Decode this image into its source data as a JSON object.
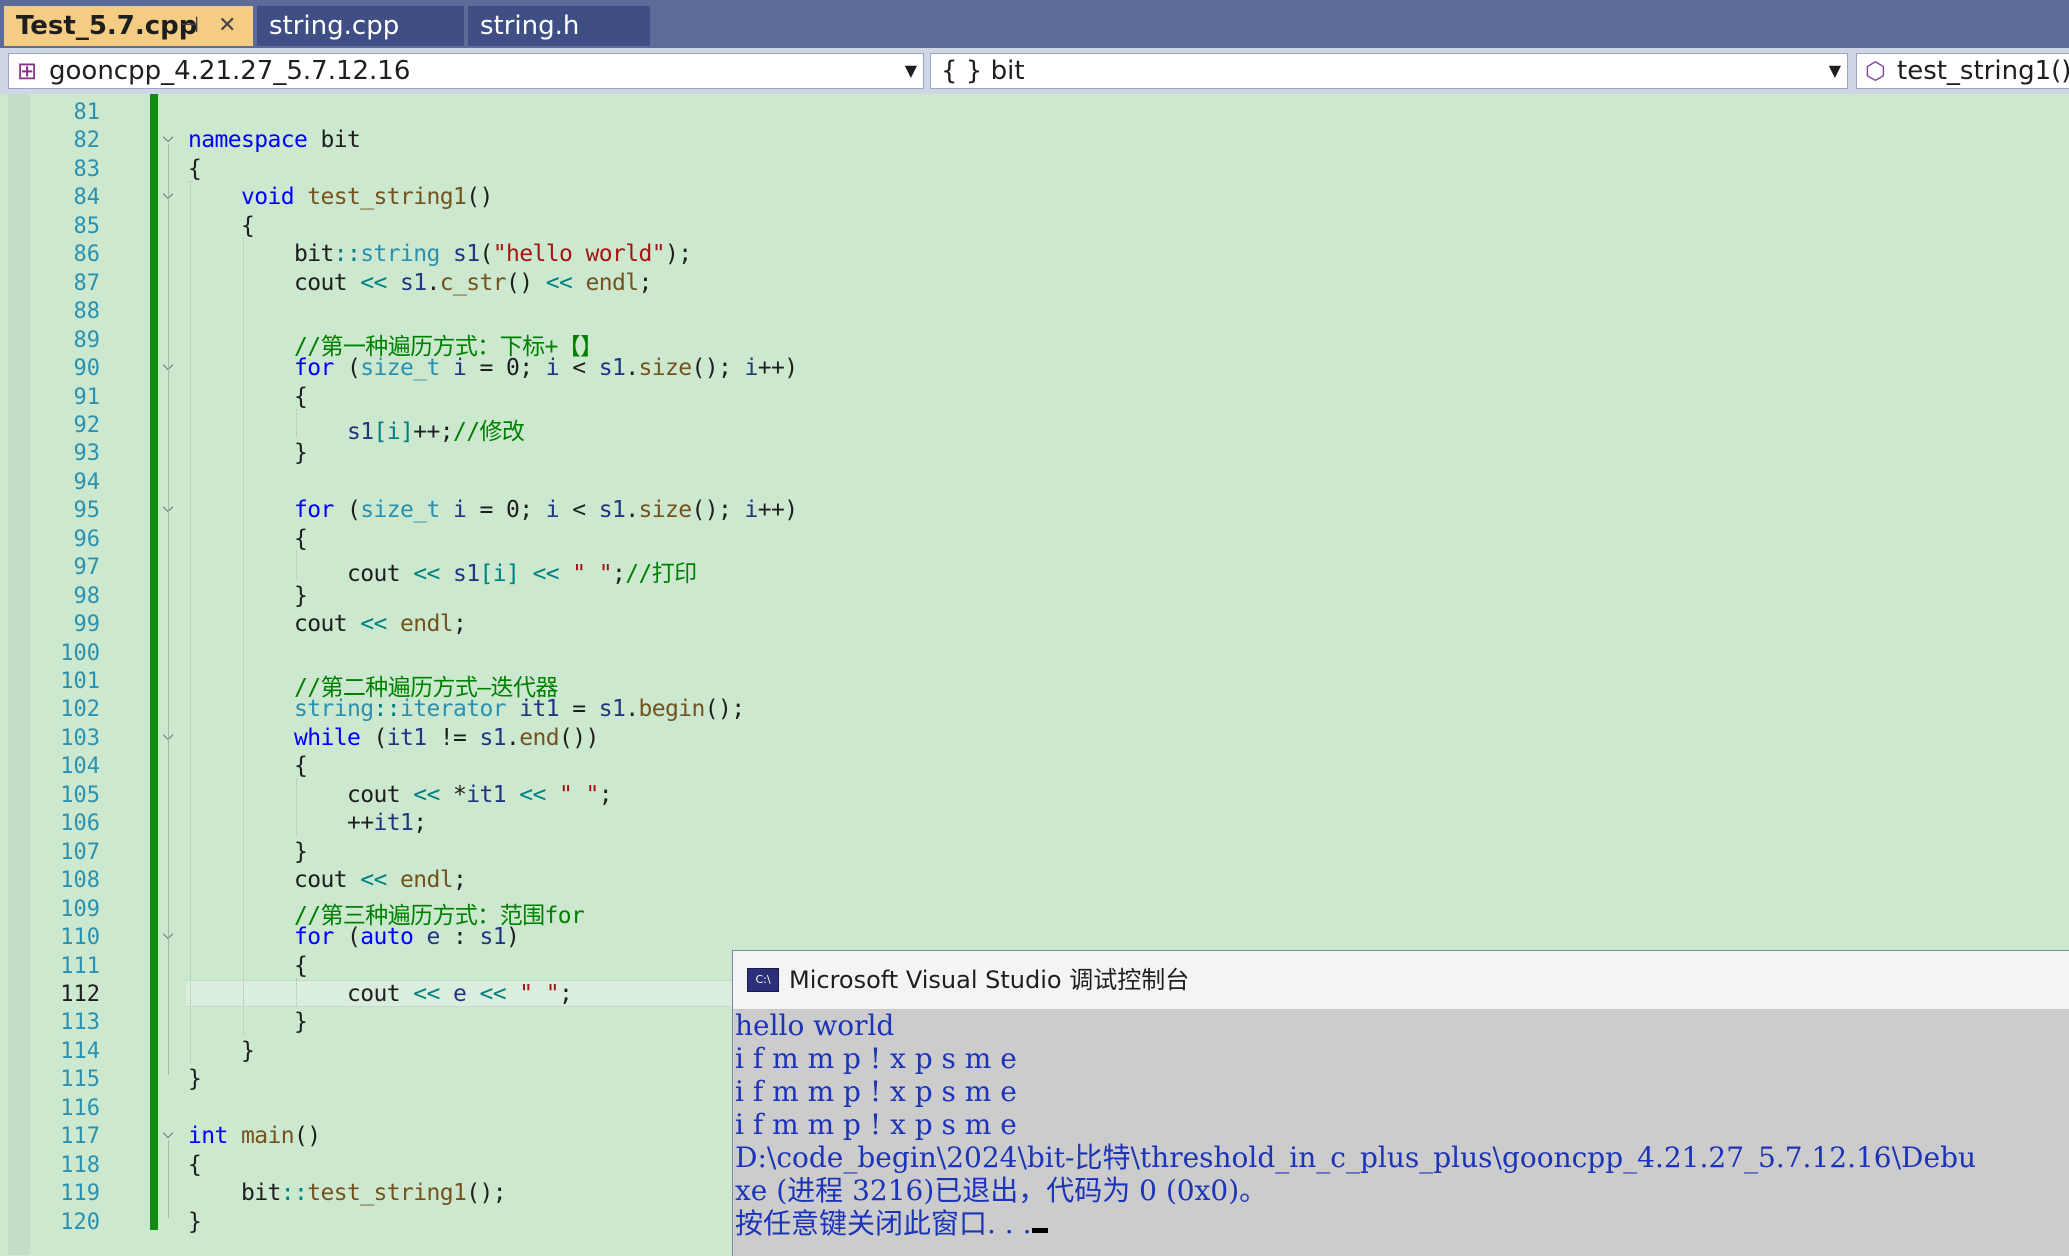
{
  "tabs": [
    {
      "label": "Test_5.7.cpp",
      "active": true,
      "pin_icon": "pin-icon",
      "close_icon": "close-icon"
    },
    {
      "label": "string.cpp",
      "active": false
    },
    {
      "label": "string.h",
      "active": false
    }
  ],
  "nav": {
    "project": "gooncpp_4.21.27_5.7.12.16",
    "scope": "{ } bit",
    "member": "test_string1()"
  },
  "editor": {
    "current_line": "112",
    "lines": [
      {
        "num": "81",
        "indent": 0,
        "fold": "",
        "tokens": []
      },
      {
        "num": "82",
        "indent": 0,
        "fold": "v",
        "tokens": [
          [
            "kw",
            "namespace"
          ],
          [
            "ns",
            " bit"
          ]
        ]
      },
      {
        "num": "83",
        "indent": 0,
        "fold": "",
        "tokens": [
          [
            "ns",
            "{"
          ]
        ]
      },
      {
        "num": "84",
        "indent": 1,
        "fold": "v",
        "tokens": [
          [
            "kw",
            "void"
          ],
          [
            "ns",
            " "
          ],
          [
            "fn",
            "test_string1"
          ],
          [
            "ns",
            "()"
          ]
        ]
      },
      {
        "num": "85",
        "indent": 1,
        "fold": "",
        "tokens": [
          [
            "ns",
            "{"
          ]
        ]
      },
      {
        "num": "86",
        "indent": 2,
        "fold": "",
        "tokens": [
          [
            "ns",
            "bit"
          ],
          [
            "op",
            "::"
          ],
          [
            "ty",
            "string"
          ],
          [
            "ns",
            " "
          ],
          [
            "va",
            "s1"
          ],
          [
            "ns",
            "("
          ],
          [
            "st",
            "\"hello world\""
          ],
          [
            "ns",
            ");"
          ]
        ]
      },
      {
        "num": "87",
        "indent": 2,
        "fold": "",
        "tokens": [
          [
            "ns",
            "cout "
          ],
          [
            "op",
            "<<"
          ],
          [
            "ns",
            " "
          ],
          [
            "va",
            "s1"
          ],
          [
            "ns",
            "."
          ],
          [
            "fn",
            "c_str"
          ],
          [
            "ns",
            "() "
          ],
          [
            "op",
            "<<"
          ],
          [
            "ns",
            " "
          ],
          [
            "fn",
            "endl"
          ],
          [
            "ns",
            ";"
          ]
        ]
      },
      {
        "num": "88",
        "indent": 2,
        "fold": "",
        "tokens": []
      },
      {
        "num": "89",
        "indent": 2,
        "fold": "",
        "tokens": [
          [
            "cm",
            "//第一种遍历方式：下标+【】"
          ]
        ]
      },
      {
        "num": "90",
        "indent": 2,
        "fold": "v",
        "tokens": [
          [
            "kw",
            "for"
          ],
          [
            "ns",
            " ("
          ],
          [
            "ty",
            "size_t"
          ],
          [
            "ns",
            " "
          ],
          [
            "va",
            "i"
          ],
          [
            "ns",
            " = 0; "
          ],
          [
            "va",
            "i"
          ],
          [
            "ns",
            " < "
          ],
          [
            "va",
            "s1"
          ],
          [
            "ns",
            "."
          ],
          [
            "fn",
            "size"
          ],
          [
            "ns",
            "(); "
          ],
          [
            "va",
            "i"
          ],
          [
            "ns",
            "++)"
          ]
        ]
      },
      {
        "num": "91",
        "indent": 2,
        "fold": "",
        "tokens": [
          [
            "ns",
            "{"
          ]
        ]
      },
      {
        "num": "92",
        "indent": 3,
        "fold": "",
        "tokens": [
          [
            "va",
            "s1"
          ],
          [
            "op",
            "[i]"
          ],
          [
            "ns",
            "++;"
          ],
          [
            "cm",
            "//修改"
          ]
        ]
      },
      {
        "num": "93",
        "indent": 2,
        "fold": "",
        "tokens": [
          [
            "ns",
            "}"
          ]
        ]
      },
      {
        "num": "94",
        "indent": 2,
        "fold": "",
        "tokens": []
      },
      {
        "num": "95",
        "indent": 2,
        "fold": "v",
        "tokens": [
          [
            "kw",
            "for"
          ],
          [
            "ns",
            " ("
          ],
          [
            "ty",
            "size_t"
          ],
          [
            "ns",
            " "
          ],
          [
            "va",
            "i"
          ],
          [
            "ns",
            " = 0; "
          ],
          [
            "va",
            "i"
          ],
          [
            "ns",
            " < "
          ],
          [
            "va",
            "s1"
          ],
          [
            "ns",
            "."
          ],
          [
            "fn",
            "size"
          ],
          [
            "ns",
            "(); "
          ],
          [
            "va",
            "i"
          ],
          [
            "ns",
            "++)"
          ]
        ]
      },
      {
        "num": "96",
        "indent": 2,
        "fold": "",
        "tokens": [
          [
            "ns",
            "{"
          ]
        ]
      },
      {
        "num": "97",
        "indent": 3,
        "fold": "",
        "tokens": [
          [
            "ns",
            "cout "
          ],
          [
            "op",
            "<<"
          ],
          [
            "ns",
            " "
          ],
          [
            "va",
            "s1"
          ],
          [
            "op",
            "[i]"
          ],
          [
            "ns",
            " "
          ],
          [
            "op",
            "<<"
          ],
          [
            "ns",
            " "
          ],
          [
            "st",
            "\" \""
          ],
          [
            "ns",
            ";"
          ],
          [
            "cm",
            "//打印"
          ]
        ]
      },
      {
        "num": "98",
        "indent": 2,
        "fold": "",
        "tokens": [
          [
            "ns",
            "}"
          ]
        ]
      },
      {
        "num": "99",
        "indent": 2,
        "fold": "",
        "tokens": [
          [
            "ns",
            "cout "
          ],
          [
            "op",
            "<<"
          ],
          [
            "ns",
            " "
          ],
          [
            "fn",
            "endl"
          ],
          [
            "ns",
            ";"
          ]
        ]
      },
      {
        "num": "100",
        "indent": 2,
        "fold": "",
        "tokens": []
      },
      {
        "num": "101",
        "indent": 2,
        "fold": "",
        "tokens": [
          [
            "cm",
            "//第二种遍历方式—迭代器"
          ]
        ]
      },
      {
        "num": "102",
        "indent": 2,
        "fold": "",
        "tokens": [
          [
            "ty",
            "string"
          ],
          [
            "op",
            "::"
          ],
          [
            "ty",
            "iterator"
          ],
          [
            "ns",
            " "
          ],
          [
            "va",
            "it1"
          ],
          [
            "ns",
            " = "
          ],
          [
            "va",
            "s1"
          ],
          [
            "ns",
            "."
          ],
          [
            "fn",
            "begin"
          ],
          [
            "ns",
            "();"
          ]
        ]
      },
      {
        "num": "103",
        "indent": 2,
        "fold": "v",
        "tokens": [
          [
            "kw",
            "while"
          ],
          [
            "ns",
            " ("
          ],
          [
            "va",
            "it1"
          ],
          [
            "ns",
            " != "
          ],
          [
            "va",
            "s1"
          ],
          [
            "ns",
            "."
          ],
          [
            "fn",
            "end"
          ],
          [
            "ns",
            "())"
          ]
        ]
      },
      {
        "num": "104",
        "indent": 2,
        "fold": "",
        "tokens": [
          [
            "ns",
            "{"
          ]
        ]
      },
      {
        "num": "105",
        "indent": 3,
        "fold": "",
        "tokens": [
          [
            "ns",
            "cout "
          ],
          [
            "op",
            "<<"
          ],
          [
            "ns",
            " *"
          ],
          [
            "va",
            "it1"
          ],
          [
            "ns",
            " "
          ],
          [
            "op",
            "<<"
          ],
          [
            "ns",
            " "
          ],
          [
            "st",
            "\" \""
          ],
          [
            "ns",
            ";"
          ]
        ]
      },
      {
        "num": "106",
        "indent": 3,
        "fold": "",
        "tokens": [
          [
            "ns",
            "++"
          ],
          [
            "va",
            "it1"
          ],
          [
            "ns",
            ";"
          ]
        ]
      },
      {
        "num": "107",
        "indent": 2,
        "fold": "",
        "tokens": [
          [
            "ns",
            "}"
          ]
        ]
      },
      {
        "num": "108",
        "indent": 2,
        "fold": "",
        "tokens": [
          [
            "ns",
            "cout "
          ],
          [
            "op",
            "<<"
          ],
          [
            "ns",
            " "
          ],
          [
            "fn",
            "endl"
          ],
          [
            "ns",
            ";"
          ]
        ]
      },
      {
        "num": "109",
        "indent": 2,
        "fold": "",
        "tokens": [
          [
            "cm",
            "//第三种遍历方式：范围for"
          ]
        ]
      },
      {
        "num": "110",
        "indent": 2,
        "fold": "v",
        "tokens": [
          [
            "kw",
            "for"
          ],
          [
            "ns",
            " ("
          ],
          [
            "kw",
            "auto"
          ],
          [
            "ns",
            " "
          ],
          [
            "va",
            "e"
          ],
          [
            "ns",
            " : "
          ],
          [
            "va",
            "s1"
          ],
          [
            "ns",
            ")"
          ]
        ]
      },
      {
        "num": "111",
        "indent": 2,
        "fold": "",
        "tokens": [
          [
            "ns",
            "{"
          ]
        ]
      },
      {
        "num": "112",
        "indent": 3,
        "fold": "",
        "tokens": [
          [
            "ns",
            "cout "
          ],
          [
            "op",
            "<<"
          ],
          [
            "ns",
            " "
          ],
          [
            "va",
            "e"
          ],
          [
            "ns",
            " "
          ],
          [
            "op",
            "<<"
          ],
          [
            "ns",
            " "
          ],
          [
            "st",
            "\" \""
          ],
          [
            "ns",
            ";"
          ]
        ]
      },
      {
        "num": "113",
        "indent": 2,
        "fold": "",
        "tokens": [
          [
            "ns",
            "}"
          ]
        ]
      },
      {
        "num": "114",
        "indent": 1,
        "fold": "",
        "tokens": [
          [
            "ns",
            "}"
          ]
        ]
      },
      {
        "num": "115",
        "indent": 0,
        "fold": "",
        "tokens": [
          [
            "ns",
            "}"
          ]
        ]
      },
      {
        "num": "116",
        "indent": 0,
        "fold": "",
        "tokens": []
      },
      {
        "num": "117",
        "indent": 0,
        "fold": "v",
        "tokens": [
          [
            "kw",
            "int"
          ],
          [
            "ns",
            " "
          ],
          [
            "fn",
            "main"
          ],
          [
            "ns",
            "()"
          ]
        ]
      },
      {
        "num": "118",
        "indent": 0,
        "fold": "",
        "tokens": [
          [
            "ns",
            "{"
          ]
        ]
      },
      {
        "num": "119",
        "indent": 1,
        "fold": "",
        "tokens": [
          [
            "ns",
            "bit"
          ],
          [
            "op",
            "::"
          ],
          [
            "fn",
            "test_string1"
          ],
          [
            "ns",
            "();"
          ]
        ]
      },
      {
        "num": "120",
        "indent": 0,
        "fold": "",
        "tokens": [
          [
            "ns",
            "}"
          ]
        ]
      }
    ]
  },
  "console": {
    "title": "Microsoft Visual Studio 调试控制台",
    "icon_label": "C:\\",
    "lines": [
      "hello world",
      "i f m m p ! x p s m e",
      "i f m m p ! x p s m e",
      "i f m m p ! x p s m e",
      "D:\\code_begin\\2024\\bit-比特\\threshold_in_c_plus_plus\\gooncpp_4.21.27_5.7.12.16\\Debu",
      "xe (进程 3216)已退出，代码为 0 (0x0)。",
      "按任意键关闭此窗口. . ."
    ]
  },
  "colors": {
    "editor_bg": "#cce8cf",
    "tabbar_bg": "#5d6b99",
    "active_tab": "#f5cc84",
    "change_bar": "#108c10",
    "console_bg": "#cccccc",
    "console_text": "#1c34b8"
  }
}
